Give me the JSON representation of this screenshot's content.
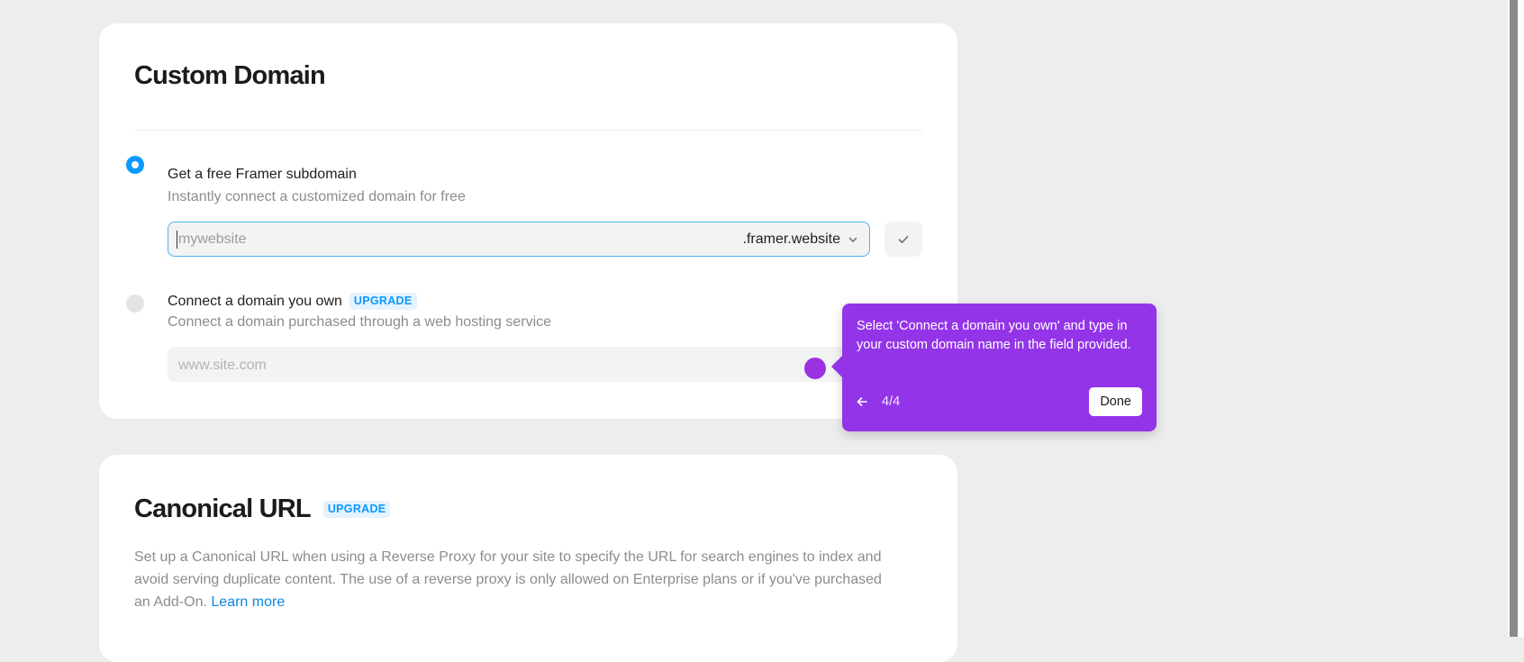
{
  "custom_domain": {
    "title": "Custom Domain",
    "free_option": {
      "title": "Get a free Framer subdomain",
      "description": "Instantly connect a customized domain for free",
      "selected": true,
      "input_value": "",
      "input_placeholder": "mywebsite",
      "suffix": ".framer.website"
    },
    "own_option": {
      "title": "Connect a domain you own",
      "badge": "UPGRADE",
      "description": "Connect a domain purchased through a web hosting service",
      "selected": false,
      "input_value": "",
      "input_placeholder": "www.site.com"
    }
  },
  "canonical_url": {
    "title": "Canonical URL",
    "badge": "UPGRADE",
    "description": "Set up a Canonical URL when using a Reverse Proxy for your site to specify the URL for search engines to index and avoid serving duplicate content. The use of a reverse proxy is only allowed on Enterprise plans or if you've purchased an Add-On.",
    "link_text": "Learn more"
  },
  "tooltip": {
    "text": "Select 'Connect a domain you own' and type in your custom domain name in the field provided.",
    "step": "4/4",
    "done_label": "Done"
  },
  "icons": {
    "check": "check-icon",
    "chevron": "chevron-down-icon",
    "back": "arrow-left-icon"
  },
  "colors": {
    "accent": "#0a99ff",
    "tooltip": "#9434e8",
    "background": "#ededed"
  }
}
